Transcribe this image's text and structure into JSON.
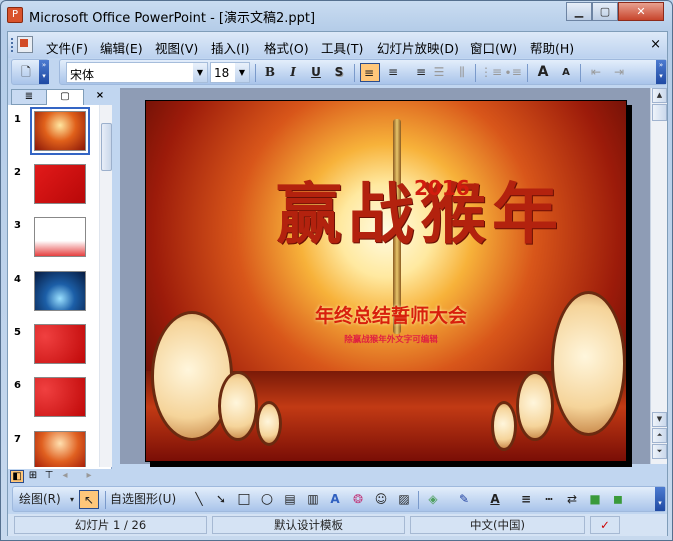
{
  "window": {
    "title": "Microsoft Office PowerPoint - [演示文稿2.ppt]",
    "minimize": "▁",
    "maximize": "▢",
    "close": "✕"
  },
  "menu": {
    "items": [
      "文件(F)",
      "编辑(E)",
      "视图(V)",
      "插入(I)",
      "格式(O)",
      "工具(T)",
      "幻灯片放映(D)",
      "窗口(W)",
      "帮助(H)"
    ],
    "close": "×"
  },
  "format_toolbar": {
    "font": "宋体",
    "size": "18",
    "bold": "B",
    "italic": "I",
    "underline": "U",
    "shadow": "S",
    "align_left": "≡",
    "align_center": "≡",
    "align_right": "≡",
    "grow": "A",
    "shrink": "A"
  },
  "left_pane": {
    "tab_outline": "≣",
    "tab_slides": "▢",
    "close": "×",
    "slides": [
      "1",
      "2",
      "3",
      "4",
      "5",
      "6",
      "7"
    ]
  },
  "slide": {
    "title": "赢战猴年",
    "year": "2016",
    "subtitle": "年终总结誓师大会",
    "note": "除赢战猴年外文字可编辑"
  },
  "draw_toolbar": {
    "draw": "绘图(R)",
    "autoshapes": "自选图形(U)"
  },
  "status": {
    "slide": "幻灯片 1 / 26",
    "template": "默认设计模板",
    "language": "中文(中国)"
  },
  "colors": {
    "accent": "#ffc77a",
    "frame": "#c1d6f0"
  }
}
